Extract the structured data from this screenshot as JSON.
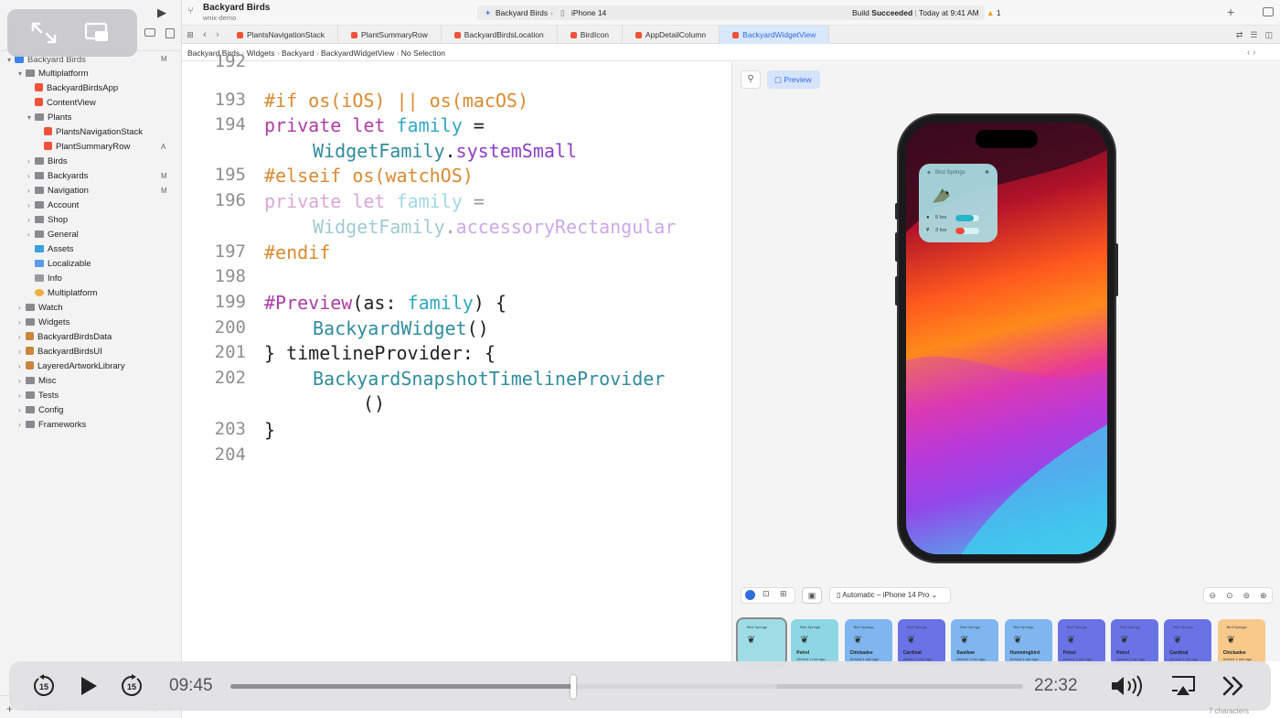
{
  "project": {
    "name": "Backyard Birds",
    "subtitle": "wnix-demo"
  },
  "scheme": {
    "target": "Backyard Birds",
    "device": "iPhone 14"
  },
  "build": {
    "status_prefix": "Build",
    "status": "Succeeded",
    "time": "Today at 9:41 AM",
    "warnings": "1"
  },
  "tabs": [
    "PlantsNavigationStack",
    "PlantSummaryRow",
    "BackyardBirdsLocation",
    "BirdIcon",
    "AppDetailColumn",
    "BackyardWidgetView"
  ],
  "breadcrumb": [
    "Backyard Birds",
    "Widgets",
    "Backyard",
    "BackyardWidgetView",
    "No Selection"
  ],
  "sidebar": {
    "root": "Backyard Birds",
    "root_badge": "M",
    "items": [
      {
        "label": "Multiplatform",
        "badge": ""
      },
      {
        "label": "BackyardBirdsApp",
        "badge": ""
      },
      {
        "label": "ContentView",
        "badge": ""
      },
      {
        "label": "Plants",
        "badge": ""
      },
      {
        "label": "PlantsNavigationStack",
        "badge": ""
      },
      {
        "label": "PlantSummaryRow",
        "badge": "A"
      },
      {
        "label": "Birds",
        "badge": ""
      },
      {
        "label": "Backyards",
        "badge": "M"
      },
      {
        "label": "Navigation",
        "badge": "M"
      },
      {
        "label": "Account",
        "badge": ""
      },
      {
        "label": "Shop",
        "badge": ""
      },
      {
        "label": "General",
        "badge": ""
      },
      {
        "label": "Assets",
        "badge": ""
      },
      {
        "label": "Localizable",
        "badge": ""
      },
      {
        "label": "Info",
        "badge": ""
      },
      {
        "label": "Multiplatform",
        "badge": ""
      },
      {
        "label": "Watch",
        "badge": ""
      },
      {
        "label": "Widgets",
        "badge": ""
      },
      {
        "label": "BackyardBirdsData",
        "badge": ""
      },
      {
        "label": "BackyardBirdsUI",
        "badge": ""
      },
      {
        "label": "LayeredArtworkLibrary",
        "badge": ""
      },
      {
        "label": "Misc",
        "badge": ""
      },
      {
        "label": "Tests",
        "badge": ""
      },
      {
        "label": "Config",
        "badge": ""
      },
      {
        "label": "Frameworks",
        "badge": ""
      }
    ],
    "filter_placeholder": "Filter"
  },
  "code": {
    "line_numbers": [
      "192",
      "193",
      "194",
      "",
      "195",
      "196",
      "",
      "197",
      "198",
      "199",
      "200",
      "201",
      "202",
      "",
      "203",
      "204"
    ],
    "l193": {
      "a": "#if os(iOS) || os(macOS)"
    },
    "l194": {
      "kw": "private let ",
      "var": "family",
      "rest": " ="
    },
    "l194b": {
      "type": "WidgetFamily",
      "dot": ".",
      "member": "systemSmall"
    },
    "l195": {
      "a": "#elseif os(watchOS)"
    },
    "l196": {
      "kw": "private let ",
      "var": "family",
      "rest": " ="
    },
    "l196b": {
      "type": "WidgetFamily",
      "dot": ".",
      "member": "accessoryRectangular"
    },
    "l197": {
      "a": "#endif"
    },
    "l199": {
      "kw": "#Preview",
      "p1": "(as: ",
      "var": "family",
      "p2": ") {"
    },
    "l200": {
      "type": "BackyardWidget",
      "rest": "()"
    },
    "l201": {
      "a": "} timelineProvider: {"
    },
    "l202": {
      "type": "BackyardSnapshotTimelineProvider"
    },
    "l202b": {
      "a": "()"
    },
    "l203": {
      "a": "}"
    }
  },
  "canvas": {
    "preview_label": "Preview",
    "device_menu": "Automatic – iPhone 14 Pro",
    "widget": {
      "title": "Bird Springs",
      "row1": "5 hrs",
      "row2": "3 hrs",
      "level1": 0.75,
      "level2": 0.4
    }
  },
  "gallery": [
    {
      "title": "Bird Springs",
      "name": "",
      "sub": ""
    },
    {
      "title": "Bird Springs",
      "name": "Petrel",
      "sub": "Arrived 1 min ago"
    },
    {
      "title": "Bird Springs",
      "name": "Chickadee",
      "sub": "Arrived 1 min ago"
    },
    {
      "title": "Bird Springs",
      "name": "Cardinal",
      "sub": "Arrived 1 min ago"
    },
    {
      "title": "Bird Springs",
      "name": "Swallow",
      "sub": "Arrived 1 min ago"
    },
    {
      "title": "Bird Springs",
      "name": "Hummingbird",
      "sub": "Arrived 1 min ago"
    },
    {
      "title": "Bird Springs",
      "name": "Petrel",
      "sub": "Arrived 1 min ago"
    },
    {
      "title": "Bird Springs",
      "name": "Petrel",
      "sub": "Arrived 1 min ago"
    },
    {
      "title": "Bird Springs",
      "name": "Cardinal",
      "sub": "Arrived 1 min ago"
    },
    {
      "title": "Bird Springs",
      "name": "Chickadee",
      "sub": "Arrived 1 min ago"
    }
  ],
  "player": {
    "current": "09:45",
    "duration": "22:32",
    "progress": 0.432,
    "buffered": 0.69
  },
  "status_bar": {
    "characters": "7 characters"
  },
  "colors": {
    "accent": "#2f6de0",
    "keyword": "#ad3da4",
    "directive": "#d98a30",
    "type": "#2f8c9c",
    "member": "#8f3ec7",
    "variable": "#2fa8c4"
  }
}
